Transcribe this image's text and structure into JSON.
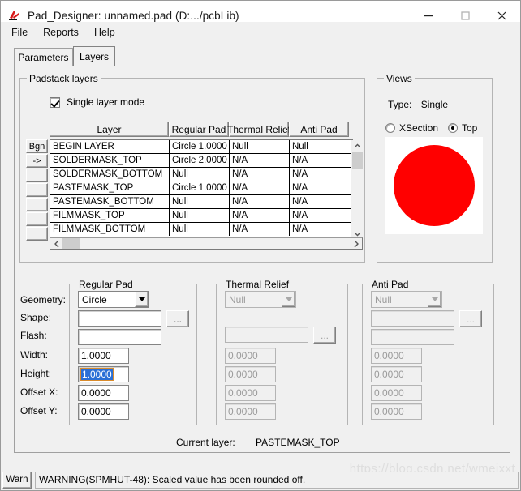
{
  "window": {
    "title": "Pad_Designer: unnamed.pad (D:.../pcbLib)",
    "icon": "app-logo-icon",
    "minimize": "─",
    "maximize": "□",
    "close": "✕"
  },
  "menu": {
    "items": [
      "File",
      "Reports",
      "Help"
    ]
  },
  "tabs": [
    {
      "label": "Parameters",
      "active": false
    },
    {
      "label": "Layers",
      "active": true
    }
  ],
  "padstack": {
    "legend": "Padstack layers",
    "single_layer_mode": {
      "label": "Single layer mode",
      "checked": true
    },
    "columns": [
      "Layer",
      "Regular Pad",
      "Thermal Relief",
      "Anti Pad"
    ],
    "side_buttons": [
      "Bgn",
      "->",
      "",
      "",
      "",
      "",
      ""
    ],
    "rows": [
      {
        "layer": "BEGIN LAYER",
        "regular_pad": "Circle 1.0000",
        "thermal_relief": "Null",
        "anti_pad": "Null"
      },
      {
        "layer": "SOLDERMASK_TOP",
        "regular_pad": "Circle 2.0000",
        "thermal_relief": "N/A",
        "anti_pad": "N/A"
      },
      {
        "layer": "SOLDERMASK_BOTTOM",
        "regular_pad": "Null",
        "thermal_relief": "N/A",
        "anti_pad": "N/A"
      },
      {
        "layer": "PASTEMASK_TOP",
        "regular_pad": "Circle 1.0000",
        "thermal_relief": "N/A",
        "anti_pad": "N/A"
      },
      {
        "layer": "PASTEMASK_BOTTOM",
        "regular_pad": "Null",
        "thermal_relief": "N/A",
        "anti_pad": "N/A"
      },
      {
        "layer": "FILMMASK_TOP",
        "regular_pad": "Null",
        "thermal_relief": "N/A",
        "anti_pad": "N/A"
      },
      {
        "layer": "FILMMASK_BOTTOM",
        "regular_pad": "Null",
        "thermal_relief": "N/A",
        "anti_pad": "N/A"
      }
    ],
    "scroll_up_icon": "chevron-up-icon",
    "scroll_down_icon": "chevron-down-icon",
    "scroll_left_icon": "chevron-left-icon",
    "scroll_right_icon": "chevron-right-icon"
  },
  "views": {
    "legend": "Views",
    "type_label": "Type:",
    "type_value": "Single",
    "options": [
      {
        "label": "XSection",
        "selected": false
      },
      {
        "label": "Top",
        "selected": true
      }
    ],
    "preview": {
      "shape": "circle",
      "color": "#FF0000",
      "background": "#FFFFFF"
    }
  },
  "regular_pad": {
    "legend": "Regular Pad",
    "labels": {
      "geometry": "Geometry:",
      "shape": "Shape:",
      "flash": "Flash:",
      "width": "Width:",
      "height": "Height:",
      "offset_x": "Offset X:",
      "offset_y": "Offset Y:"
    },
    "geometry": "Circle",
    "shape": "",
    "flash": "",
    "width": "1.0000",
    "height": "1.0000",
    "offset_x": "0.0000",
    "offset_y": "0.0000",
    "browse_label": "...",
    "height_selected": true
  },
  "thermal_relief": {
    "legend": "Thermal Relief",
    "geometry": "Null",
    "shape": "",
    "values": [
      "0.0000",
      "0.0000",
      "0.0000",
      "0.0000"
    ],
    "browse_label": "...",
    "enabled": false
  },
  "anti_pad": {
    "legend": "Anti Pad",
    "geometry": "Null",
    "shape": "",
    "flash": "",
    "values": [
      "0.0000",
      "0.0000",
      "0.0000",
      "0.0000"
    ],
    "browse_label": "...",
    "enabled": false
  },
  "current_layer": {
    "label": "Current layer:",
    "value": "PASTEMASK_TOP"
  },
  "statusbar": {
    "severity": "Warn",
    "message": "WARNING(SPMHUT-48): Scaled value has been rounded off.",
    "watermark": "https://blog.csdn.net/wmeixxt"
  },
  "colors": {
    "window_bg": "#f0f0f0",
    "titlebar_bg": "#ffffff",
    "pad_red": "#FF0000",
    "selection_blue": "#2a6fd6",
    "border": "#a0a0a0"
  }
}
